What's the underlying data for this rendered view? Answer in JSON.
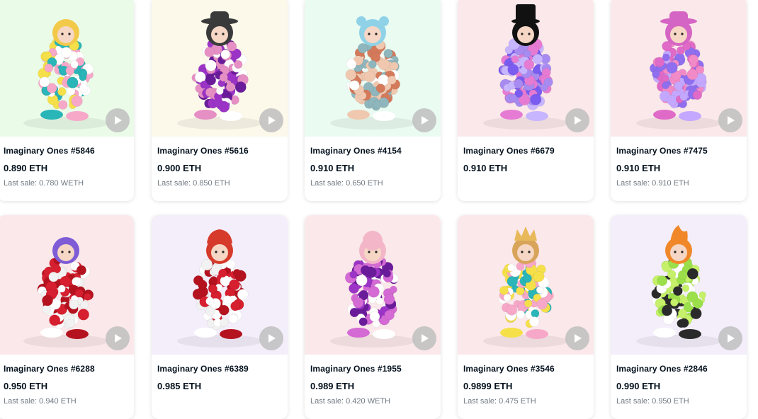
{
  "items": [
    {
      "name": "Imaginary Ones #5846",
      "price": "0.890 ETH",
      "last_sale": "Last sale: 0.780 WETH",
      "bg": "#eafbe8",
      "balls": [
        "#f6e04a",
        "#2ab5b8",
        "#f7a8c9",
        "#ffffff"
      ],
      "head": "#f3c94a",
      "hat": "helmet"
    },
    {
      "name": "Imaginary Ones #5616",
      "price": "0.900 ETH",
      "last_sale": "Last sale: 0.850 ETH",
      "bg": "#fcf8ea",
      "balls": [
        "#9b34c6",
        "#e58fc4",
        "#ffffff",
        "#6a1b9a"
      ],
      "head": "#3a3a3a",
      "hat": "fedora"
    },
    {
      "name": "Imaginary Ones #4154",
      "price": "0.910 ETH",
      "last_sale": "Last sale: 0.650 ETH",
      "bg": "#eafbf1",
      "balls": [
        "#8fb6bd",
        "#f0c8b0",
        "#ffffff",
        "#d47a5a"
      ],
      "head": "#8fd2e8",
      "hat": "beanie"
    },
    {
      "name": "Imaginary Ones #6679",
      "price": "0.910 ETH",
      "last_sale": "",
      "bg": "#fbe8ea",
      "balls": [
        "#a88bf0",
        "#e67bd4",
        "#c8b5ff",
        "#7a5cf0"
      ],
      "head": "#111111",
      "hat": "tophat"
    },
    {
      "name": "Imaginary Ones #7475",
      "price": "0.910 ETH",
      "last_sale": "Last sale: 0.910 ETH",
      "bg": "#fbe8ea",
      "balls": [
        "#8f6ff0",
        "#e06ac7",
        "#c4a8ff",
        "#f28ac8"
      ],
      "head": "#d565c4",
      "hat": "cowboy"
    },
    {
      "name": "Imaginary Ones #6288",
      "price": "0.950 ETH",
      "last_sale": "Last sale: 0.940 ETH",
      "bg": "#fbe8ea",
      "balls": [
        "#d61f2f",
        "#ffffff",
        "#b5121f",
        "#f2f2f2"
      ],
      "head": "#7d5cd6",
      "hat": "helmet"
    },
    {
      "name": "Imaginary Ones #6389",
      "price": "0.985 ETH",
      "last_sale": "",
      "bg": "#f4eefb",
      "balls": [
        "#d61f2f",
        "#ffffff",
        "#b5121f",
        "#f2f2f2"
      ],
      "head": "#d63a2a",
      "hat": "fire"
    },
    {
      "name": "Imaginary Ones #1955",
      "price": "0.989 ETH",
      "last_sale": "Last sale: 0.420 WETH",
      "bg": "#fbe8ea",
      "balls": [
        "#9b34c6",
        "#d46ad4",
        "#ffffff",
        "#6a1b9a"
      ],
      "head": "#f3b6c8",
      "hat": "sheep"
    },
    {
      "name": "Imaginary Ones #3546",
      "price": "0.9899 ETH",
      "last_sale": "Last sale: 0.475 ETH",
      "bg": "#fbe8ea",
      "balls": [
        "#2ab5b8",
        "#f6e04a",
        "#f7a8c9",
        "#ffffff"
      ],
      "head": "#d8a45a",
      "hat": "crown"
    },
    {
      "name": "Imaginary Ones #2846",
      "price": "0.990 ETH",
      "last_sale": "Last sale: 0.950 ETH",
      "bg": "#f4eefb",
      "balls": [
        "#9be04a",
        "#ffffff",
        "#2a2a2a",
        "#c6f06a"
      ],
      "head": "#f0882a",
      "hat": "flame"
    }
  ]
}
